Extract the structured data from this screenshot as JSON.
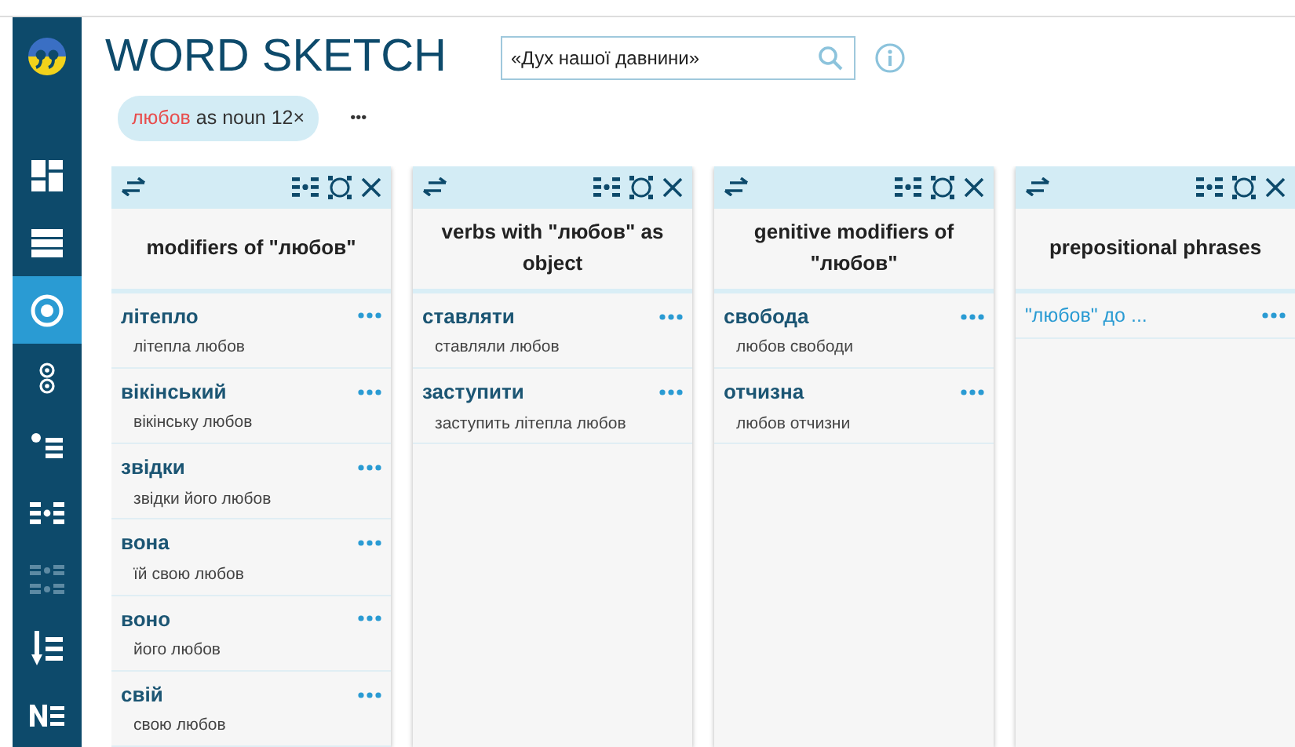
{
  "sidebar": {
    "items": [
      {
        "kind": "dashboard",
        "selected": false,
        "disabled": false
      },
      {
        "kind": "list",
        "selected": false,
        "disabled": false
      },
      {
        "kind": "target",
        "selected": true,
        "disabled": false
      },
      {
        "kind": "double",
        "selected": false,
        "disabled": false
      },
      {
        "kind": "bullets",
        "selected": false,
        "disabled": false
      },
      {
        "kind": "compare",
        "selected": false,
        "disabled": false
      },
      {
        "kind": "compare2",
        "selected": false,
        "disabled": true
      },
      {
        "kind": "sort",
        "selected": false,
        "disabled": false
      },
      {
        "kind": "ne",
        "selected": false,
        "disabled": false
      }
    ]
  },
  "header": {
    "title": "WORD SKETCH",
    "search": {
      "value": "«Дух нашої давнини»"
    }
  },
  "query_chip": {
    "lemma": "любов",
    "rest": "as noun 12×"
  },
  "more_label": "•••",
  "columns": [
    {
      "title": "modifiers of \"любов\"",
      "rows": [
        {
          "kind": "word",
          "headword": "літепло",
          "example": "літепла любов"
        },
        {
          "kind": "word",
          "headword": "вікінський",
          "example": "вікінську любов"
        },
        {
          "kind": "word",
          "headword": "звідки",
          "example": "звідки його любов"
        },
        {
          "kind": "word",
          "headword": "вона",
          "example": "їй свою любов"
        },
        {
          "kind": "word",
          "headword": "воно",
          "example": "його любов"
        },
        {
          "kind": "word",
          "headword": "свій",
          "example": "свою любов"
        }
      ]
    },
    {
      "title": "verbs with \"любов\" as object",
      "rows": [
        {
          "kind": "word",
          "headword": "ставляти",
          "example": "ставляли любов"
        },
        {
          "kind": "word",
          "headword": "заступити",
          "example": "заступить літепла любов"
        }
      ]
    },
    {
      "title": "genitive modifiers of \"любов\"",
      "rows": [
        {
          "kind": "word",
          "headword": "свобода",
          "example": "любов свободи"
        },
        {
          "kind": "word",
          "headword": "отчизна",
          "example": "любов отчизни"
        }
      ]
    },
    {
      "title": "prepositional phrases",
      "rows": [
        {
          "kind": "phrase",
          "headword": "\"любов\" до ..."
        }
      ]
    }
  ]
}
